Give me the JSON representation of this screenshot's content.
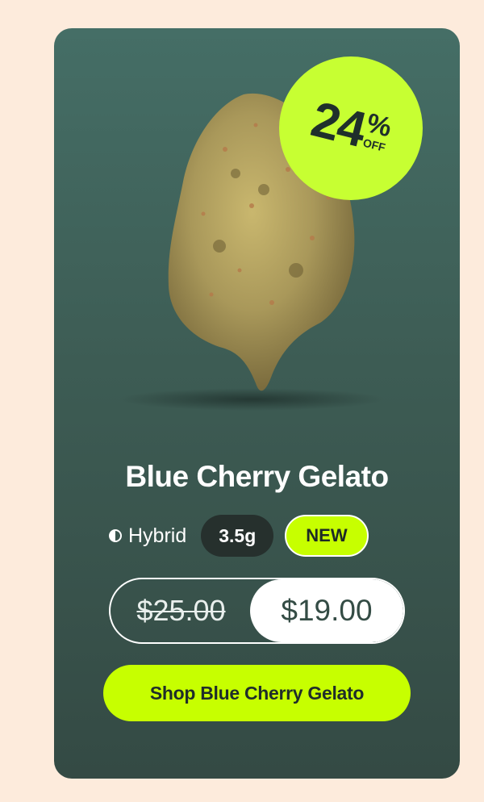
{
  "colors": {
    "page_background": "#fdebdc",
    "card_background": "#3d5c54",
    "accent": "#c7ff00",
    "badge": "#c7ff32"
  },
  "badge": {
    "number": "24",
    "percent": "%",
    "off": "OFF"
  },
  "product": {
    "name": "Blue Cherry Gelato",
    "image": "cannabis-bud-icon",
    "strain_icon": "half-circle-icon",
    "strain": "Hybrid",
    "weight": "3.5g",
    "tag": "NEW"
  },
  "price": {
    "original": "$25.00",
    "sale": "$19.00"
  },
  "cta": {
    "label": "Shop Blue Cherry Gelato"
  }
}
